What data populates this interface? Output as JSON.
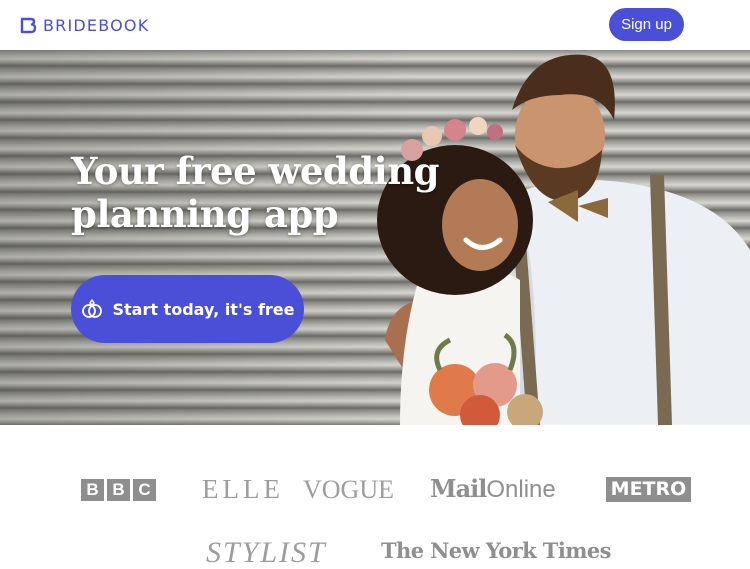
{
  "header": {
    "brand": "BRIDEBOOK",
    "logo_icon": "bridebook-logo-icon",
    "signup_label": "Sign up"
  },
  "hero": {
    "headline_line1": "Your free wedding",
    "headline_line2": "planning app",
    "cta_label": "Start today, it's free",
    "cta_icon": "rings-icon",
    "image_description_icon": "couple-photo"
  },
  "press": {
    "logos": [
      "BBC",
      "ELLE",
      "VOGUE",
      "MailOnline",
      "METRO",
      "STYLIST",
      "The New York Times"
    ],
    "bbc_letters": [
      "B",
      "B",
      "C"
    ],
    "mail_bold": "Mail",
    "mail_light": "Online"
  },
  "colors": {
    "brand": "#4a4fd8",
    "press_gray": "#9a9a9a",
    "white": "#ffffff"
  }
}
